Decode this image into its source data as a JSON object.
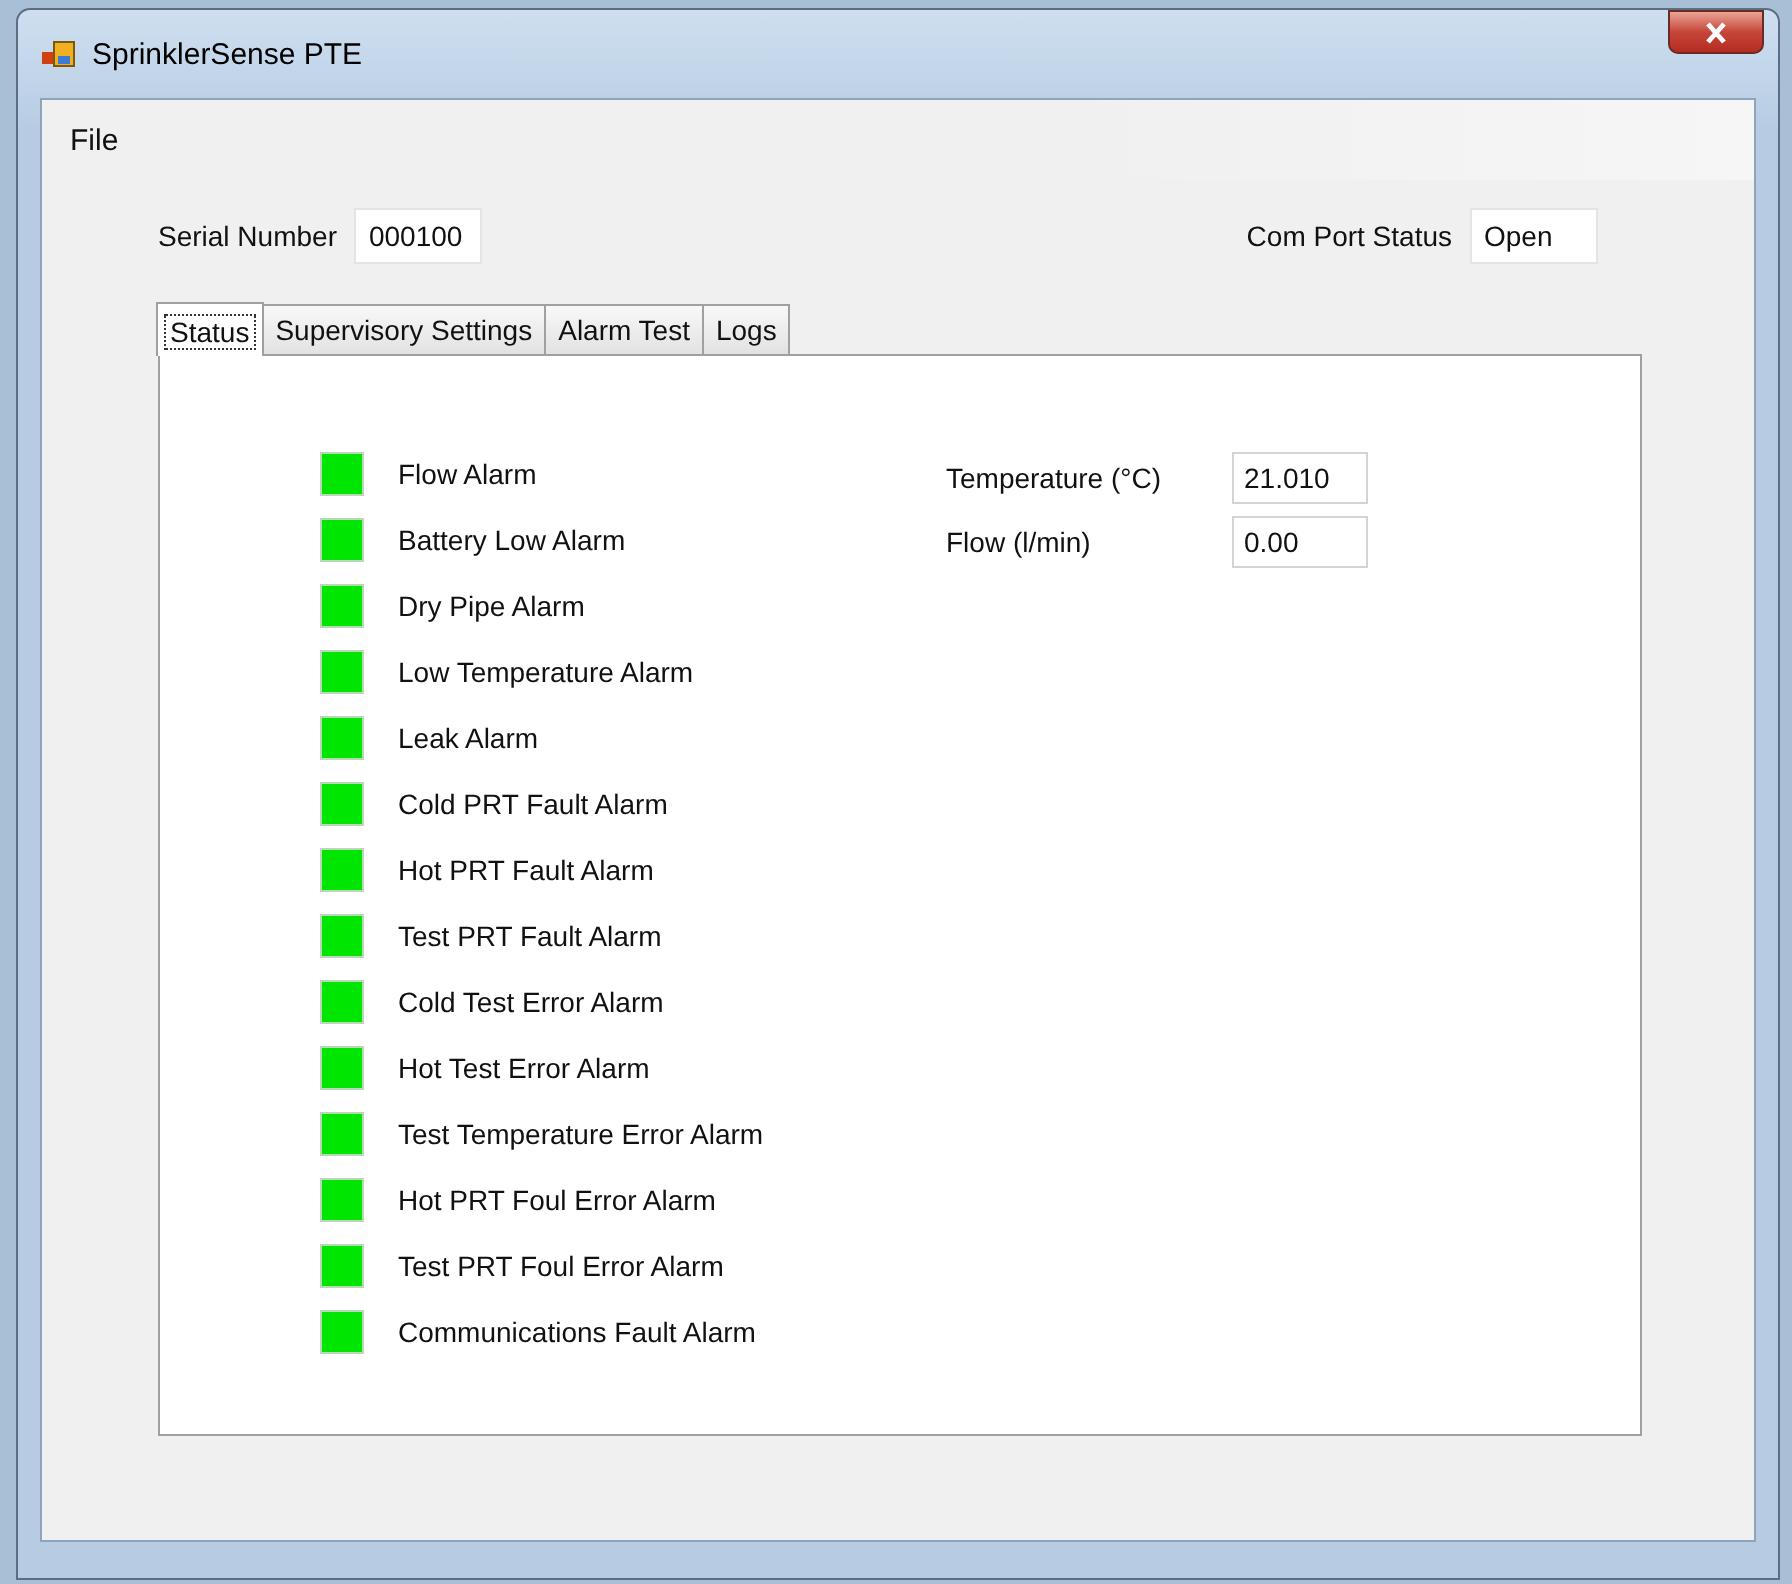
{
  "window": {
    "title": "SprinklerSense PTE"
  },
  "menu": [
    "File"
  ],
  "serial_number": {
    "label": "Serial Number",
    "value": "000100"
  },
  "com_port_status": {
    "label": "Com Port Status",
    "value": "Open"
  },
  "tabs": [
    {
      "label": "Status",
      "selected": true
    },
    {
      "label": "Supervisory Settings",
      "selected": false
    },
    {
      "label": "Alarm Test",
      "selected": false
    },
    {
      "label": "Logs",
      "selected": false
    }
  ],
  "alarms": [
    {
      "label": "Flow Alarm",
      "color": "#00e600"
    },
    {
      "label": "Battery Low Alarm",
      "color": "#00e600"
    },
    {
      "label": "Dry Pipe Alarm",
      "color": "#00e600"
    },
    {
      "label": "Low Temperature Alarm",
      "color": "#00e600"
    },
    {
      "label": "Leak Alarm",
      "color": "#00e600"
    },
    {
      "label": "Cold PRT Fault Alarm",
      "color": "#00e600"
    },
    {
      "label": "Hot PRT Fault Alarm",
      "color": "#00e600"
    },
    {
      "label": "Test PRT Fault Alarm",
      "color": "#00e600"
    },
    {
      "label": "Cold Test Error Alarm",
      "color": "#00e600"
    },
    {
      "label": "Hot Test Error Alarm",
      "color": "#00e600"
    },
    {
      "label": "Test Temperature Error Alarm",
      "color": "#00e600"
    },
    {
      "label": "Hot PRT Foul Error Alarm",
      "color": "#00e600"
    },
    {
      "label": "Test PRT Foul Error Alarm",
      "color": "#00e600"
    },
    {
      "label": "Communications Fault Alarm",
      "color": "#00e600"
    }
  ],
  "readings": [
    {
      "label": "Temperature (°C)",
      "value": "21.010"
    },
    {
      "label": "Flow (l/min)",
      "value": "0.00"
    }
  ]
}
